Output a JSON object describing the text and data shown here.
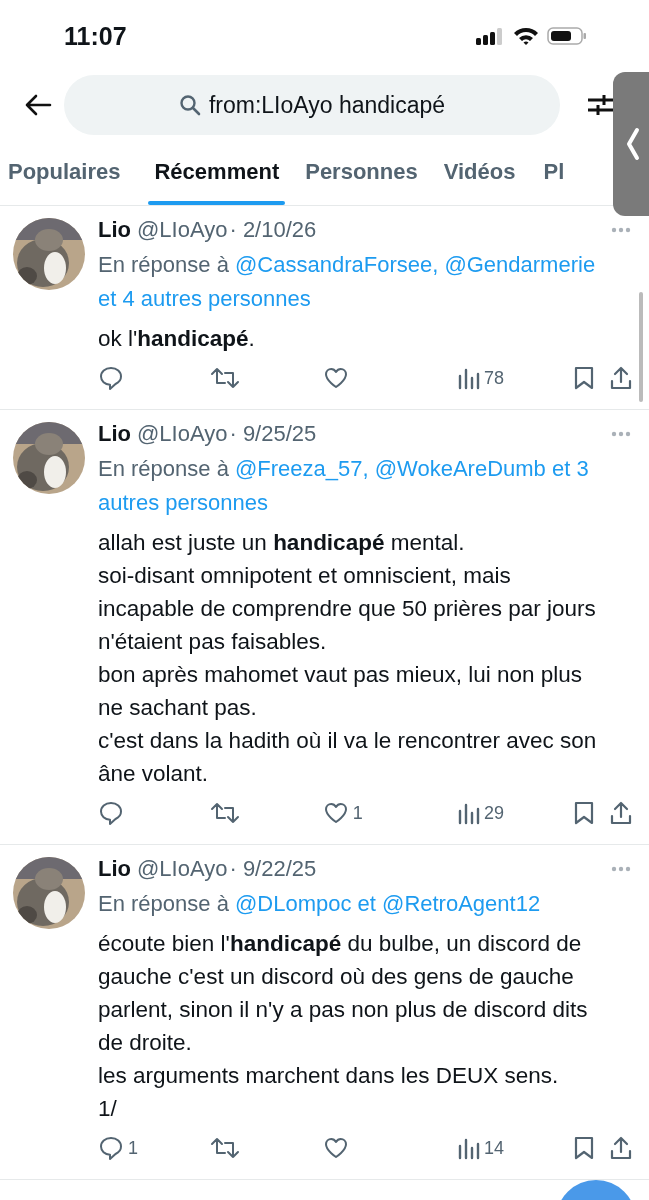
{
  "status_bar": {
    "time": "11:07"
  },
  "search": {
    "value": "from:LIoAyo handicapé"
  },
  "tabs": [
    {
      "label": "Populaires",
      "selected": false
    },
    {
      "label": "Récemment",
      "selected": true
    },
    {
      "label": "Personnes",
      "selected": false
    },
    {
      "label": "Vidéos",
      "selected": false
    },
    {
      "label": "Pl",
      "selected": false
    }
  ],
  "tweets": [
    {
      "name": "Lio",
      "handle": "@LIoAyo",
      "date": "· 2/10/26",
      "reply_prefix": "En réponse à",
      "reply_to": "@CassandraForsee, @Gendarmerie et 4 autres personnes",
      "body": [
        "ok l'**handicapé**."
      ],
      "views": "78"
    },
    {
      "name": "Lio",
      "handle": "@LIoAyo",
      "date": "· 9/25/25",
      "reply_prefix": "En réponse à",
      "reply_to": "@Freeza_57, @WokeAreDumb et 3 autres personnes",
      "body": [
        "allah est juste un **handicapé** mental.",
        "soi-disant omnipotent et omniscient, mais incapable de comprendre que 50 prières par jours n'étaient pas faisables.",
        "bon après mahomet vaut pas mieux, lui non plus ne sachant pas.",
        "c'est dans la hadith où il va le rencontrer avec son âne volant."
      ],
      "likes": "1",
      "views": "29"
    },
    {
      "name": "Lio",
      "handle": "@LIoAyo",
      "date": "· 9/22/25",
      "reply_prefix": "En réponse à",
      "reply_to": "@DLompoc et @RetroAgent12",
      "body": [
        "écoute bien l'**handicapé** du bulbe, un discord de gauche c'est un discord où des gens de gauche parlent, sinon il n'y a pas non plus de discord dits de droite.",
        "les arguments marchent dans les DEUX sens.",
        "1/"
      ],
      "replies": "1",
      "views": "14"
    }
  ]
}
